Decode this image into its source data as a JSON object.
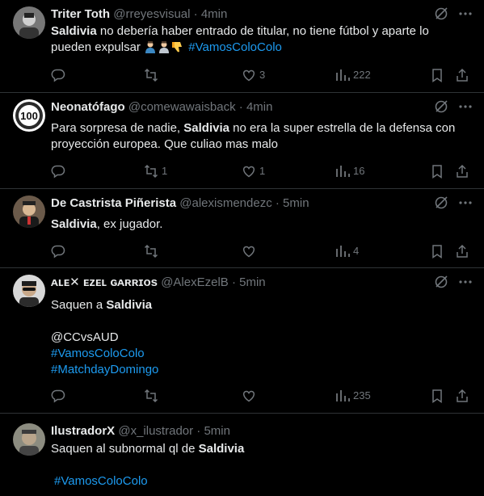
{
  "colors": {
    "background": "#000000",
    "text": "#e7e9ea",
    "muted": "#71767b",
    "link": "#1d9bf0",
    "border": "#2f3336"
  },
  "icons": {
    "more": "more-dots-icon",
    "grok": "grok-slash-icon",
    "reply": "reply-icon",
    "retweet": "retweet-icon",
    "like": "heart-icon",
    "views": "views-bars-icon",
    "bookmark": "bookmark-icon",
    "share": "share-icon"
  },
  "tweets": [
    {
      "name": "Triter Toth",
      "handle": "@rreyesvisual",
      "sep": "·",
      "time": "4min",
      "t0_bold": "Saldivia",
      "t0_rest": " no debería haber entrado de titular, no tiene fútbol y aparte lo",
      "t1_text": "pueden expulsar ",
      "t1_link": "#VamosColoColo",
      "emojis": [
        "person-shrugging-emoji",
        "person-shrugging-emoji",
        "thumbs-down-emoji"
      ],
      "reply": "",
      "retweet": "",
      "like": "3",
      "views": "222"
    },
    {
      "name": "Neonatófago",
      "handle": "@comewawaisback",
      "sep": "·",
      "time": "4min",
      "t0_pre": "Para sorpresa de nadie, ",
      "t0_bold": "Saldivia",
      "t0_rest": " no era la super estrella de la defensa con",
      "t1_text": "proyección europea. Que culiao mas malo",
      "reply": "",
      "retweet": "1",
      "like": "1",
      "views": "16"
    },
    {
      "name": "De Castrista Piñerista",
      "handle": "@alexismendezc",
      "sep": "·",
      "time": "5min",
      "t0_bold": "Saldivia",
      "t0_rest": ", ex jugador.",
      "reply": "",
      "retweet": "",
      "like": "",
      "views": "4"
    },
    {
      "name": "ᴀʟᴇ✕ ᴇᴢᴇʟ ɢᴀʀʀɪᴏs",
      "handle": "@AlexEzelB",
      "sep": "·",
      "time": "5min",
      "t0_pre": "Saquen a ",
      "t0_bold": "Saldivia",
      "t2_text": "@CCvsAUD",
      "t3_link": "#VamosColoColo",
      "t4_link": "#MatchdayDomingo",
      "reply": "",
      "retweet": "",
      "like": "",
      "views": "235"
    },
    {
      "name": "IlustradorX",
      "handle": "@x_ilustrador",
      "sep": "·",
      "time": "5min",
      "t0_pre": "Saquen al subnormal ql de ",
      "t0_bold": "Saldivia",
      "t2_link": "#VamosColoColo"
    }
  ]
}
